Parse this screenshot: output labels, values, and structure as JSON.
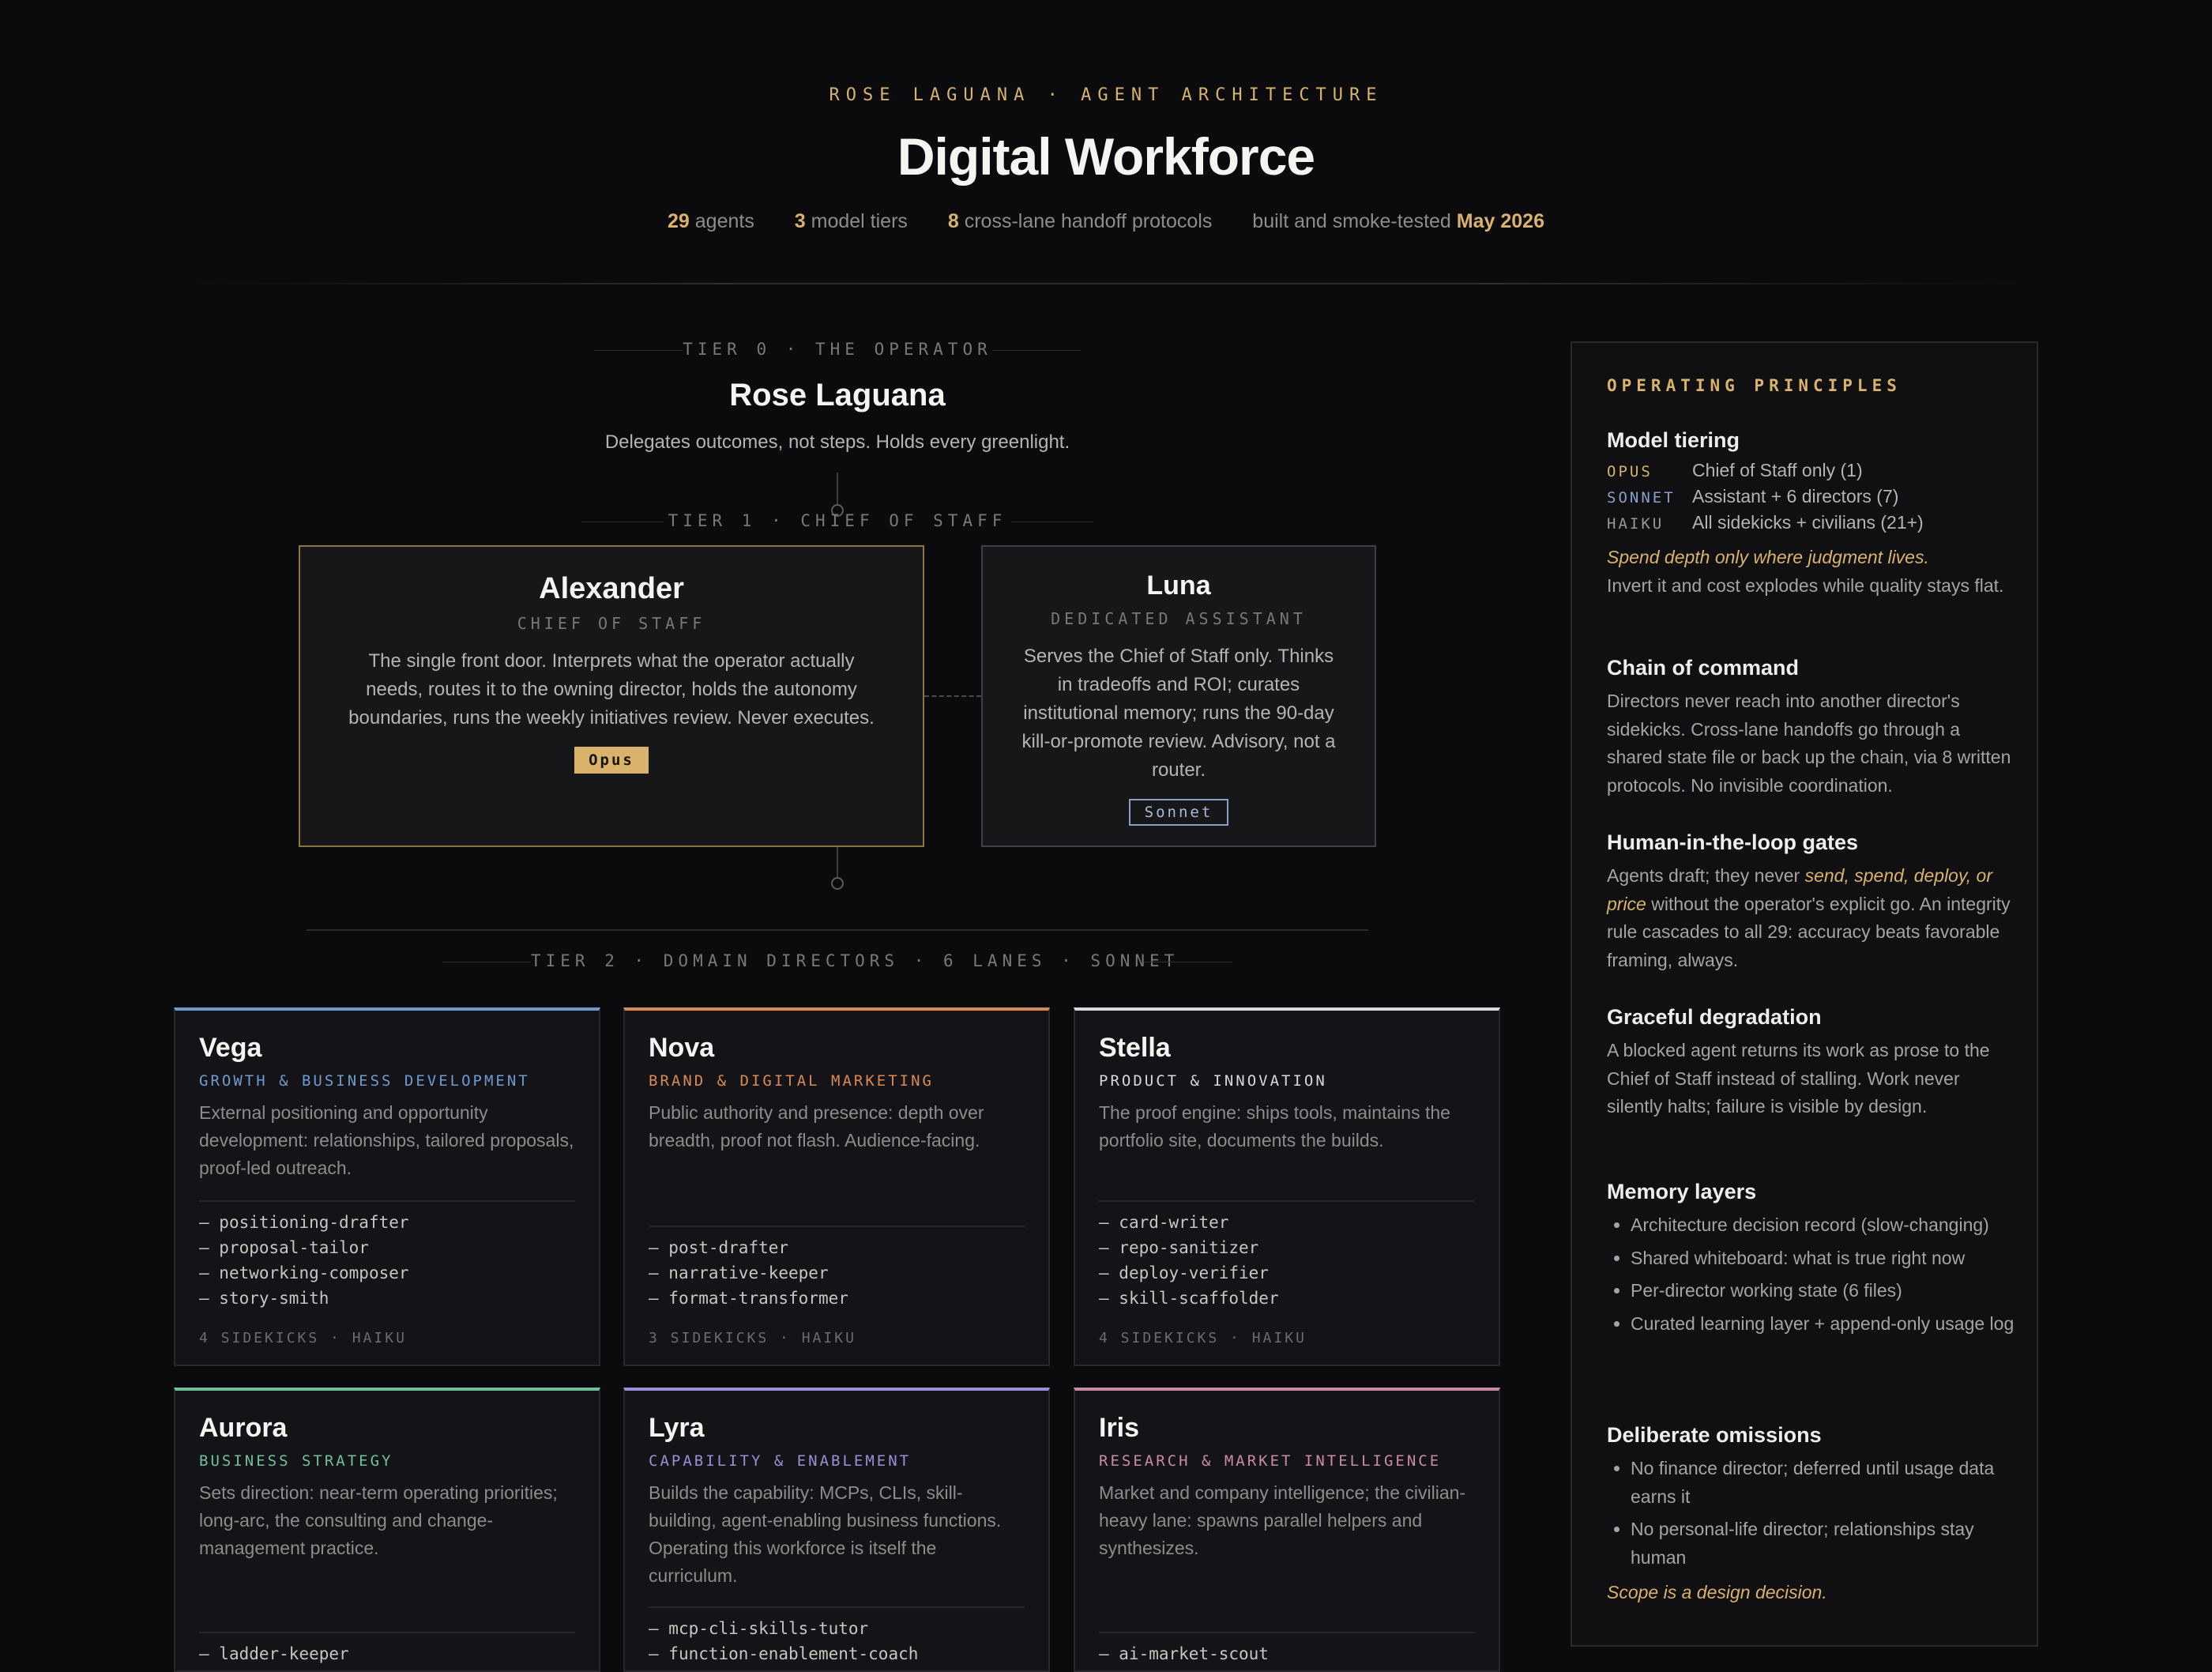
{
  "header": {
    "eyebrow": "ROSE LAGUANA · AGENT ARCHITECTURE",
    "title": "Digital Workforce",
    "stats": [
      {
        "num": "29",
        "label": "agents"
      },
      {
        "num": "3",
        "label": "model tiers"
      },
      {
        "num": "8",
        "label": "cross-lane handoff protocols"
      }
    ],
    "built_label": "built and smoke-tested",
    "built_date": "May 2026"
  },
  "tier0": {
    "label": "TIER 0 · THE OPERATOR",
    "name": "Rose Laguana",
    "desc": "Delegates outcomes, not steps. Holds every greenlight."
  },
  "tier1": {
    "label": "TIER 1 · CHIEF OF STAFF",
    "chief": {
      "name": "Alexander",
      "role": "CHIEF OF STAFF",
      "desc": "The single front door. Interprets what the operator actually needs, routes it to the owning director, holds the autonomy boundaries, runs the weekly initiatives review. Never executes.",
      "model": "Opus"
    },
    "assistant": {
      "name": "Luna",
      "role": "DEDICATED ASSISTANT",
      "desc": "Serves the Chief of Staff only. Thinks in tradeoffs and ROI; curates institutional memory; runs the 90-day kill-or-promote review. Advisory, not a router.",
      "model": "Sonnet"
    }
  },
  "tier2": {
    "label": "TIER 2 · DOMAIN DIRECTORS · 6 LANES · SONNET",
    "directors": [
      {
        "name": "Vega",
        "subtitle": "GROWTH & BUSINESS DEVELOPMENT",
        "color": "#6f9ad0",
        "desc": "External positioning and opportunity development: relationships, tailored proposals, proof-led outreach.",
        "sidekicks": [
          "positioning-drafter",
          "proposal-tailor",
          "networking-composer",
          "story-smith"
        ],
        "footer": "4 SIDEKICKS · HAIKU"
      },
      {
        "name": "Nova",
        "subtitle": "BRAND & DIGITAL MARKETING",
        "color": "#d98a52",
        "desc": "Public authority and presence: depth over breadth, proof not flash. Audience-facing.",
        "sidekicks": [
          "post-drafter",
          "narrative-keeper",
          "format-transformer"
        ],
        "footer": "3 SIDEKICKS · HAIKU"
      },
      {
        "name": "Stella",
        "subtitle": "PRODUCT & INNOVATION",
        "color": "#d8d8dc",
        "desc": "The proof engine: ships tools, maintains the portfolio site, documents the builds.",
        "sidekicks": [
          "card-writer",
          "repo-sanitizer",
          "deploy-verifier",
          "skill-scaffolder"
        ],
        "footer": "4 SIDEKICKS · HAIKU"
      },
      {
        "name": "Aurora",
        "subtitle": "BUSINESS STRATEGY",
        "color": "#6fbf9a",
        "desc": "Sets direction: near-term operating priorities; long-arc, the consulting and change-management practice.",
        "sidekicks": [
          "ladder-keeper"
        ],
        "footer": ""
      },
      {
        "name": "Lyra",
        "subtitle": "CAPABILITY & ENABLEMENT",
        "color": "#9b8ed6",
        "desc": "Builds the capability: MCPs, CLIs, skill-building, agent-enabling business functions. Operating this workforce is itself the curriculum.",
        "sidekicks": [
          "mcp-cli-skills-tutor",
          "function-enablement-coach"
        ],
        "footer": ""
      },
      {
        "name": "Iris",
        "subtitle": "RESEARCH & MARKET INTELLIGENCE",
        "color": "#c98aa8",
        "desc": "Market and company intelligence; the civilian-heavy lane: spawns parallel helpers and synthesizes.",
        "sidekicks": [
          "ai-market-scout"
        ],
        "footer": ""
      }
    ]
  },
  "principles": {
    "title": "OPERATING PRINCIPLES",
    "model_tiering": {
      "heading": "Model tiering",
      "rows": [
        {
          "key": "OPUS",
          "value": "Chief of Staff only (1)",
          "color": "#d9b26c"
        },
        {
          "key": "SONNET",
          "value": "Assistant + 6 directors (7)",
          "color": "#8aa0c8"
        },
        {
          "key": "HAIKU",
          "value": "All sidekicks + civilians (21+)",
          "color": "#9a9894"
        }
      ],
      "emphasis": "Spend depth only where judgment lives.",
      "text": "Invert it and cost explodes while quality stays flat."
    },
    "chain": {
      "heading": "Chain of command",
      "text": "Directors never reach into another director's sidekicks. Cross-lane handoffs go through a shared state file or back up the chain, via 8 written protocols. No invisible coordination."
    },
    "hitl": {
      "heading": "Human-in-the-loop gates",
      "text_before": "Agents draft; they never ",
      "emphasis": "send, spend, deploy, or price",
      "text_after": " without the operator's explicit go. An integrity rule cascades to all 29: accuracy beats favorable framing, always."
    },
    "degradation": {
      "heading": "Graceful degradation",
      "text": "A blocked agent returns its work as prose to the Chief of Staff instead of stalling. Work never silently halts; failure is visible by design."
    },
    "memory": {
      "heading": "Memory layers",
      "items": [
        "Architecture decision record (slow-changing)",
        "Shared whiteboard: what is true right now",
        "Per-director working state (6 files)",
        "Curated learning layer + append-only usage log"
      ]
    },
    "omissions": {
      "heading": "Deliberate omissions",
      "items": [
        "No finance director; deferred until usage data earns it",
        "No personal-life director; relationships stay human"
      ],
      "closing": "Scope is a design decision."
    }
  }
}
